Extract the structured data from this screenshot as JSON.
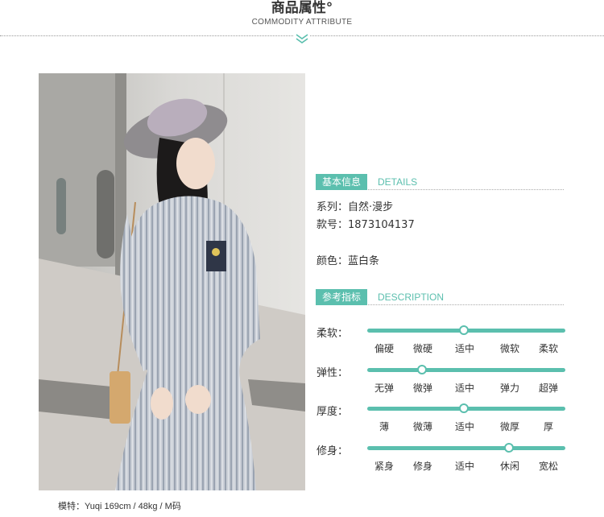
{
  "header": {
    "title": "商品属性°",
    "subtitle": "COMMODITY ATTRIBUTE"
  },
  "caption": "模特：Yuqi   169cm / 48kg / M码",
  "basic": {
    "tag": "基本信息",
    "en": "DETAILS",
    "series": "系列：自然·漫步",
    "code": "款号：1873104137",
    "color": "颜色：蓝白条"
  },
  "reference": {
    "tag": "参考指标",
    "en": "DESCRIPTION"
  },
  "indicators": [
    {
      "label": "柔软：",
      "options": [
        "偏硬",
        "微硬",
        "适中",
        "微软",
        "柔软"
      ],
      "selected": 2
    },
    {
      "label": "弹性：",
      "options": [
        "无弹",
        "微弹",
        "适中",
        "弹力",
        "超弹"
      ],
      "selected": 1
    },
    {
      "label": "厚度：",
      "options": [
        "薄",
        "微薄",
        "适中",
        "微厚",
        "厚"
      ],
      "selected": 2
    },
    {
      "label": "修身：",
      "options": [
        "紧身",
        "修身",
        "适中",
        "休闲",
        "宽松"
      ],
      "selected": 3
    }
  ],
  "colors": {
    "accent": "#5bbfae"
  }
}
